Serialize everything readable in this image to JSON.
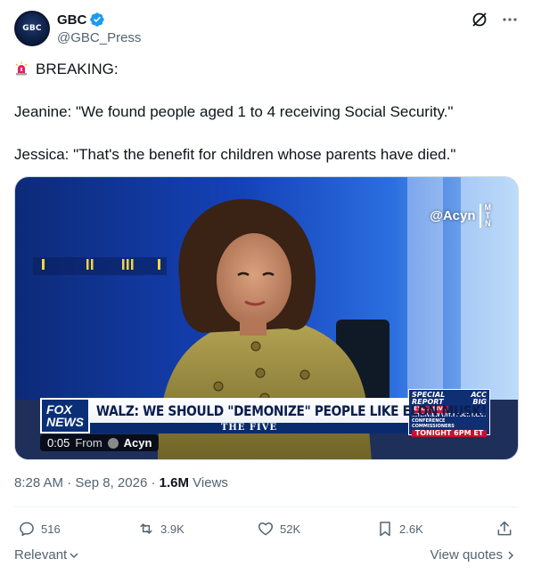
{
  "author": {
    "name": "GBC",
    "handle": "@GBC_Press",
    "avatar_text": "GBC",
    "verified": true
  },
  "header_icons": [
    "grok-icon",
    "more-icon"
  ],
  "tweet": {
    "line1_emoji": "siren-icon",
    "line1": "BREAKING:",
    "line2": "Jeanine: \"We found people aged 1 to 4 receiving Social Security.\"",
    "line3": "Jessica: \"That's the benefit for children whose parents have died.\""
  },
  "media": {
    "watermark": "@Acyn",
    "watermark_tag": "MTN",
    "logo_text_1": "FOX",
    "logo_text_2": "NEWS",
    "chyron": "WALZ: WE SHOULD \"DEMONIZE\" PEOPLE LIKE ELON MUSK!",
    "show_name": "THE FIVE",
    "promo_1": "SPECIAL",
    "promo_2": "REPORT",
    "promo_conf1": "ACC",
    "promo_conf2": "BIG",
    "promo_excl": "EXCLUSIVE",
    "promo_desc": "INTERVIEW WITH FOUR NCAA CONFERENCE COMMISSIONERS",
    "promo_time": "TONIGHT 6PM ET",
    "duration": "0:05",
    "from_label": "From",
    "source": "Acyn"
  },
  "meta": {
    "time": "8:28 AM",
    "date": "Sep 8, 2026",
    "views_num": "1.6M",
    "views_label": "Views"
  },
  "actions": {
    "replies": "516",
    "reposts": "3.9K",
    "likes": "52K",
    "bookmarks": "2.6K"
  },
  "footer": {
    "sort_label": "Relevant",
    "view_quotes": "View quotes"
  },
  "colors": {
    "verified": "#1d9bf0",
    "muted": "#536471",
    "text": "#0f1419"
  }
}
